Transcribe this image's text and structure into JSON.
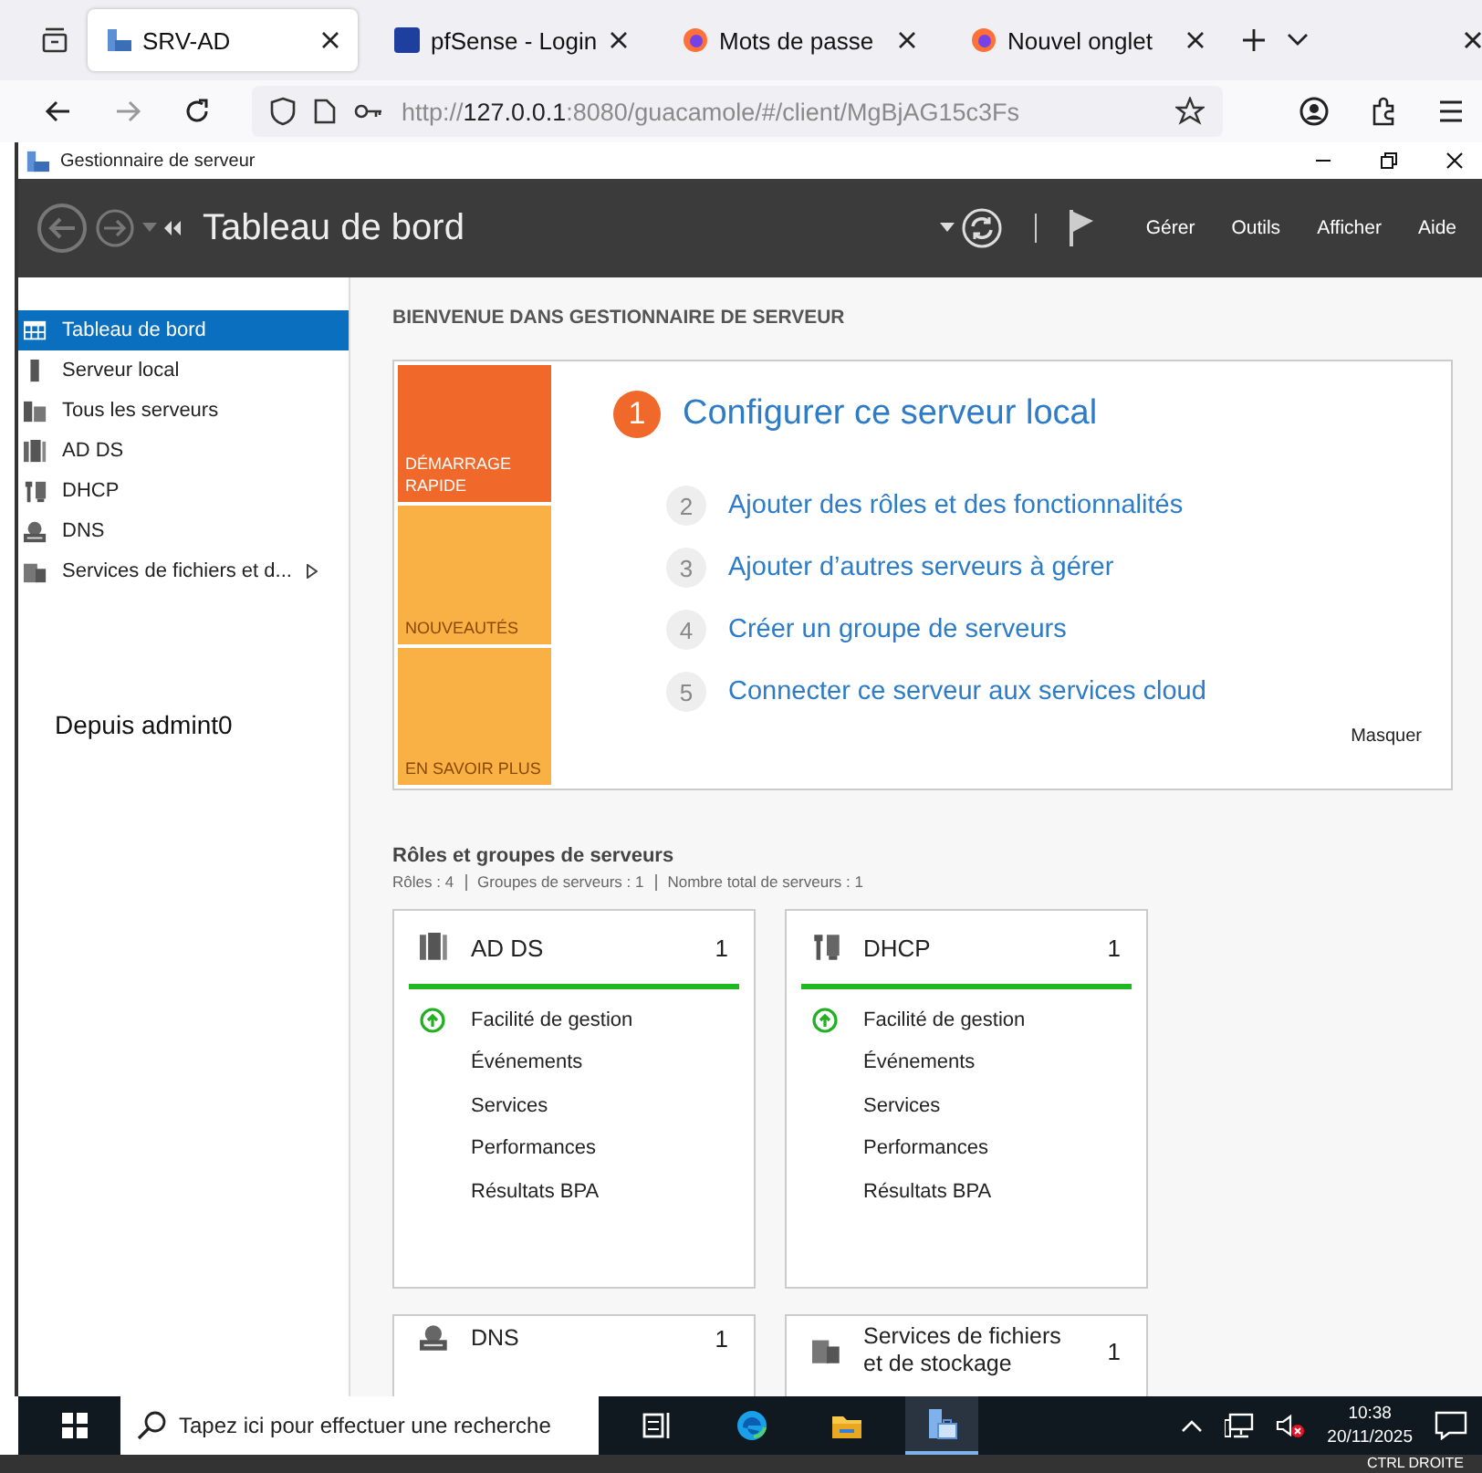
{
  "browser": {
    "tabs": [
      {
        "label": "SRV-AD",
        "kind": "server-manager",
        "selected": true
      },
      {
        "label": "pfSense - Login",
        "kind": "pf",
        "selected": false
      },
      {
        "label": "Mots de passe",
        "kind": "firefox",
        "selected": false
      },
      {
        "label": "Nouvel onglet",
        "kind": "firefox",
        "selected": false
      }
    ],
    "url": {
      "scheme": "http://",
      "host": "127.0.0.1",
      "path": ":8080/guacamole/#/client/MgBjAG15c3Fs"
    }
  },
  "remote_window": {
    "title": "Gestionnaire de serveur"
  },
  "header": {
    "title": "Tableau de bord",
    "menu": [
      "Gérer",
      "Outils",
      "Afficher",
      "Aide"
    ]
  },
  "sidebar": {
    "items": [
      {
        "label": "Tableau de bord",
        "kind": "dashboard",
        "selected": true,
        "submenu": false
      },
      {
        "label": "Serveur local",
        "kind": "server",
        "selected": false,
        "submenu": false
      },
      {
        "label": "Tous les serveurs",
        "kind": "servers",
        "selected": false,
        "submenu": false
      },
      {
        "label": "AD DS",
        "kind": "adds",
        "selected": false,
        "submenu": false
      },
      {
        "label": "DHCP",
        "kind": "dhcp",
        "selected": false,
        "submenu": false
      },
      {
        "label": "DNS",
        "kind": "dns",
        "selected": false,
        "submenu": false
      },
      {
        "label": "Services de fichiers et d...",
        "kind": "files",
        "selected": false,
        "submenu": true
      }
    ],
    "note": "Depuis admint0"
  },
  "welcome": {
    "heading": "BIENVENUE DANS GESTIONNAIRE DE SERVEUR",
    "tiles": [
      {
        "label": "DÉMARRAGE RAPIDE",
        "selected": true
      },
      {
        "label": "NOUVEAUTÉS",
        "selected": false
      },
      {
        "label": "EN SAVOIR PLUS",
        "selected": false
      }
    ],
    "steps": [
      {
        "number": "1",
        "label": "Configurer ce serveur local",
        "kind": "primary"
      },
      {
        "number": "2",
        "label": "Ajouter des rôles et des fonctionnalités",
        "kind": "secondary"
      },
      {
        "number": "3",
        "label": "Ajouter d’autres serveurs à gérer",
        "kind": "secondary"
      },
      {
        "number": "4",
        "label": "Créer un groupe de serveurs",
        "kind": "secondary"
      },
      {
        "number": "5",
        "label": "Connecter ce serveur aux services cloud",
        "kind": "secondary"
      }
    ],
    "hide": "Masquer"
  },
  "roles": {
    "title": "Rôles et groupes de serveurs",
    "summary": [
      "Rôles : 4",
      "Groupes de serveurs : 1",
      "Nombre total de serveurs : 1"
    ],
    "cards": [
      {
        "title": "AD DS",
        "kind": "adds",
        "count": "1",
        "healthy": true,
        "items": [
          "Facilité de gestion",
          "Événements",
          "Services",
          "Performances",
          "Résultats BPA"
        ]
      },
      {
        "title": "DHCP",
        "kind": "dhcp",
        "count": "1",
        "healthy": true,
        "items": [
          "Facilité de gestion",
          "Événements",
          "Services",
          "Performances",
          "Résultats BPA"
        ]
      },
      {
        "title": "DNS",
        "kind": "dns",
        "count": "1",
        "healthy": false
      },
      {
        "title": "Services de fichiers et de stockage",
        "kind": "files",
        "count": "1",
        "healthy": false
      }
    ]
  },
  "taskbar": {
    "search": {
      "placeholder": "Tapez ici pour effectuer une recherche"
    },
    "apps": [
      {
        "kind": "task-view",
        "selected": false
      },
      {
        "kind": "edge",
        "selected": false
      },
      {
        "kind": "folder",
        "selected": false
      },
      {
        "kind": "server-manager",
        "selected": true
      }
    ],
    "time": "10:38",
    "date": "20/11/2025"
  },
  "host_bar": {
    "text": "CTRL DROITE"
  }
}
